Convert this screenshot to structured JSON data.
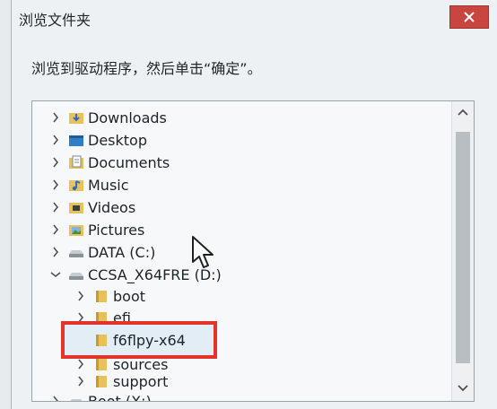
{
  "dialog": {
    "title": "浏览文件夹",
    "prompt": "浏览到驱动程序，然后单击“确定”。"
  },
  "tree": {
    "items": [
      {
        "label": "Downloads",
        "icon": "downloads-folder-icon"
      },
      {
        "label": "Desktop",
        "icon": "desktop-folder-icon"
      },
      {
        "label": "Documents",
        "icon": "documents-folder-icon"
      },
      {
        "label": "Music",
        "icon": "music-folder-icon"
      },
      {
        "label": "Videos",
        "icon": "videos-folder-icon"
      },
      {
        "label": "Pictures",
        "icon": "pictures-folder-icon"
      },
      {
        "label": "DATA (C:)",
        "icon": "drive-icon"
      },
      {
        "label": "CCSA_X64FRE (D:)",
        "icon": "drive-icon"
      },
      {
        "label": "boot",
        "icon": "folder-icon"
      },
      {
        "label": "efi",
        "icon": "folder-icon"
      },
      {
        "label": "f6flpy-x64",
        "icon": "folder-icon",
        "selected": true
      },
      {
        "label": "sources",
        "icon": "folder-icon"
      },
      {
        "label": "support",
        "icon": "folder-icon"
      },
      {
        "label": "Boot (X:)",
        "icon": "drive-icon"
      }
    ]
  },
  "colors": {
    "highlight_border": "#e3342b",
    "close_button": "#c8463f",
    "folder_yellow": "#e8c15a"
  }
}
